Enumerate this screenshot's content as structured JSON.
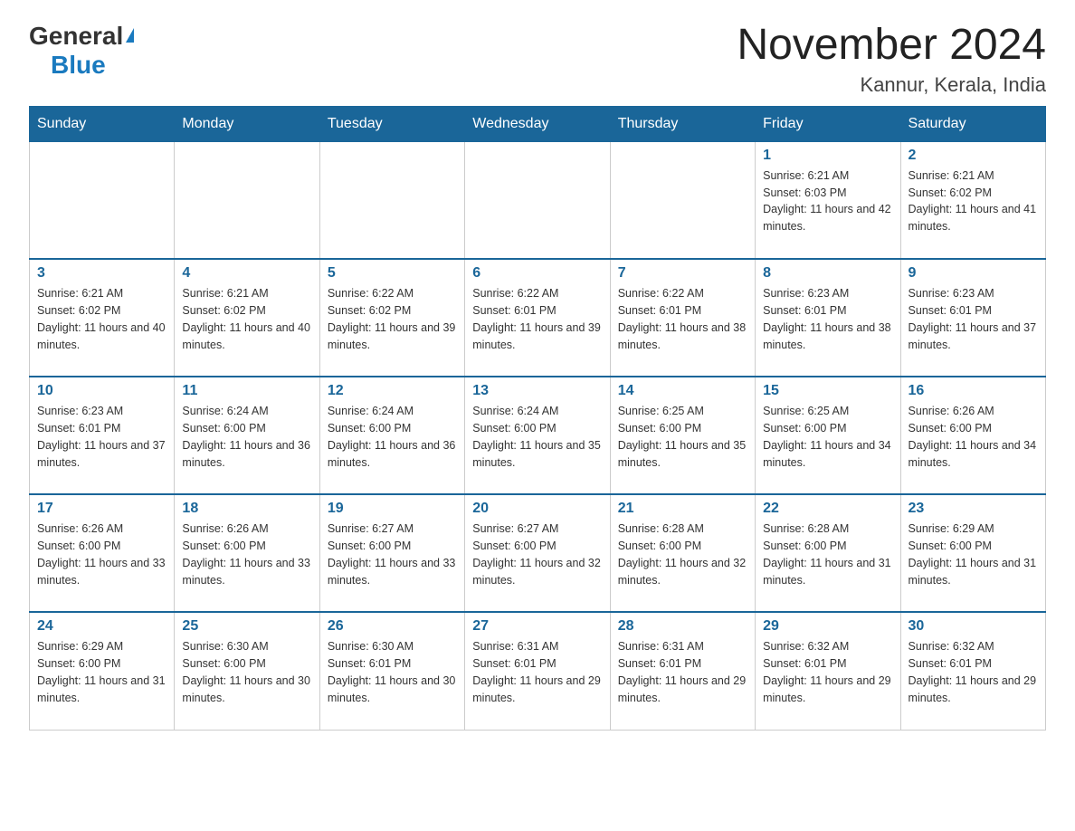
{
  "header": {
    "month_title": "November 2024",
    "location": "Kannur, Kerala, India",
    "logo_general": "General",
    "logo_blue": "Blue"
  },
  "days_of_week": [
    "Sunday",
    "Monday",
    "Tuesday",
    "Wednesday",
    "Thursday",
    "Friday",
    "Saturday"
  ],
  "weeks": [
    {
      "days": [
        {
          "num": "",
          "sunrise": "",
          "sunset": "",
          "daylight": ""
        },
        {
          "num": "",
          "sunrise": "",
          "sunset": "",
          "daylight": ""
        },
        {
          "num": "",
          "sunrise": "",
          "sunset": "",
          "daylight": ""
        },
        {
          "num": "",
          "sunrise": "",
          "sunset": "",
          "daylight": ""
        },
        {
          "num": "",
          "sunrise": "",
          "sunset": "",
          "daylight": ""
        },
        {
          "num": "1",
          "sunrise": "Sunrise: 6:21 AM",
          "sunset": "Sunset: 6:03 PM",
          "daylight": "Daylight: 11 hours and 42 minutes."
        },
        {
          "num": "2",
          "sunrise": "Sunrise: 6:21 AM",
          "sunset": "Sunset: 6:02 PM",
          "daylight": "Daylight: 11 hours and 41 minutes."
        }
      ]
    },
    {
      "days": [
        {
          "num": "3",
          "sunrise": "Sunrise: 6:21 AM",
          "sunset": "Sunset: 6:02 PM",
          "daylight": "Daylight: 11 hours and 40 minutes."
        },
        {
          "num": "4",
          "sunrise": "Sunrise: 6:21 AM",
          "sunset": "Sunset: 6:02 PM",
          "daylight": "Daylight: 11 hours and 40 minutes."
        },
        {
          "num": "5",
          "sunrise": "Sunrise: 6:22 AM",
          "sunset": "Sunset: 6:02 PM",
          "daylight": "Daylight: 11 hours and 39 minutes."
        },
        {
          "num": "6",
          "sunrise": "Sunrise: 6:22 AM",
          "sunset": "Sunset: 6:01 PM",
          "daylight": "Daylight: 11 hours and 39 minutes."
        },
        {
          "num": "7",
          "sunrise": "Sunrise: 6:22 AM",
          "sunset": "Sunset: 6:01 PM",
          "daylight": "Daylight: 11 hours and 38 minutes."
        },
        {
          "num": "8",
          "sunrise": "Sunrise: 6:23 AM",
          "sunset": "Sunset: 6:01 PM",
          "daylight": "Daylight: 11 hours and 38 minutes."
        },
        {
          "num": "9",
          "sunrise": "Sunrise: 6:23 AM",
          "sunset": "Sunset: 6:01 PM",
          "daylight": "Daylight: 11 hours and 37 minutes."
        }
      ]
    },
    {
      "days": [
        {
          "num": "10",
          "sunrise": "Sunrise: 6:23 AM",
          "sunset": "Sunset: 6:01 PM",
          "daylight": "Daylight: 11 hours and 37 minutes."
        },
        {
          "num": "11",
          "sunrise": "Sunrise: 6:24 AM",
          "sunset": "Sunset: 6:00 PM",
          "daylight": "Daylight: 11 hours and 36 minutes."
        },
        {
          "num": "12",
          "sunrise": "Sunrise: 6:24 AM",
          "sunset": "Sunset: 6:00 PM",
          "daylight": "Daylight: 11 hours and 36 minutes."
        },
        {
          "num": "13",
          "sunrise": "Sunrise: 6:24 AM",
          "sunset": "Sunset: 6:00 PM",
          "daylight": "Daylight: 11 hours and 35 minutes."
        },
        {
          "num": "14",
          "sunrise": "Sunrise: 6:25 AM",
          "sunset": "Sunset: 6:00 PM",
          "daylight": "Daylight: 11 hours and 35 minutes."
        },
        {
          "num": "15",
          "sunrise": "Sunrise: 6:25 AM",
          "sunset": "Sunset: 6:00 PM",
          "daylight": "Daylight: 11 hours and 34 minutes."
        },
        {
          "num": "16",
          "sunrise": "Sunrise: 6:26 AM",
          "sunset": "Sunset: 6:00 PM",
          "daylight": "Daylight: 11 hours and 34 minutes."
        }
      ]
    },
    {
      "days": [
        {
          "num": "17",
          "sunrise": "Sunrise: 6:26 AM",
          "sunset": "Sunset: 6:00 PM",
          "daylight": "Daylight: 11 hours and 33 minutes."
        },
        {
          "num": "18",
          "sunrise": "Sunrise: 6:26 AM",
          "sunset": "Sunset: 6:00 PM",
          "daylight": "Daylight: 11 hours and 33 minutes."
        },
        {
          "num": "19",
          "sunrise": "Sunrise: 6:27 AM",
          "sunset": "Sunset: 6:00 PM",
          "daylight": "Daylight: 11 hours and 33 minutes."
        },
        {
          "num": "20",
          "sunrise": "Sunrise: 6:27 AM",
          "sunset": "Sunset: 6:00 PM",
          "daylight": "Daylight: 11 hours and 32 minutes."
        },
        {
          "num": "21",
          "sunrise": "Sunrise: 6:28 AM",
          "sunset": "Sunset: 6:00 PM",
          "daylight": "Daylight: 11 hours and 32 minutes."
        },
        {
          "num": "22",
          "sunrise": "Sunrise: 6:28 AM",
          "sunset": "Sunset: 6:00 PM",
          "daylight": "Daylight: 11 hours and 31 minutes."
        },
        {
          "num": "23",
          "sunrise": "Sunrise: 6:29 AM",
          "sunset": "Sunset: 6:00 PM",
          "daylight": "Daylight: 11 hours and 31 minutes."
        }
      ]
    },
    {
      "days": [
        {
          "num": "24",
          "sunrise": "Sunrise: 6:29 AM",
          "sunset": "Sunset: 6:00 PM",
          "daylight": "Daylight: 11 hours and 31 minutes."
        },
        {
          "num": "25",
          "sunrise": "Sunrise: 6:30 AM",
          "sunset": "Sunset: 6:00 PM",
          "daylight": "Daylight: 11 hours and 30 minutes."
        },
        {
          "num": "26",
          "sunrise": "Sunrise: 6:30 AM",
          "sunset": "Sunset: 6:01 PM",
          "daylight": "Daylight: 11 hours and 30 minutes."
        },
        {
          "num": "27",
          "sunrise": "Sunrise: 6:31 AM",
          "sunset": "Sunset: 6:01 PM",
          "daylight": "Daylight: 11 hours and 29 minutes."
        },
        {
          "num": "28",
          "sunrise": "Sunrise: 6:31 AM",
          "sunset": "Sunset: 6:01 PM",
          "daylight": "Daylight: 11 hours and 29 minutes."
        },
        {
          "num": "29",
          "sunrise": "Sunrise: 6:32 AM",
          "sunset": "Sunset: 6:01 PM",
          "daylight": "Daylight: 11 hours and 29 minutes."
        },
        {
          "num": "30",
          "sunrise": "Sunrise: 6:32 AM",
          "sunset": "Sunset: 6:01 PM",
          "daylight": "Daylight: 11 hours and 29 minutes."
        }
      ]
    }
  ]
}
